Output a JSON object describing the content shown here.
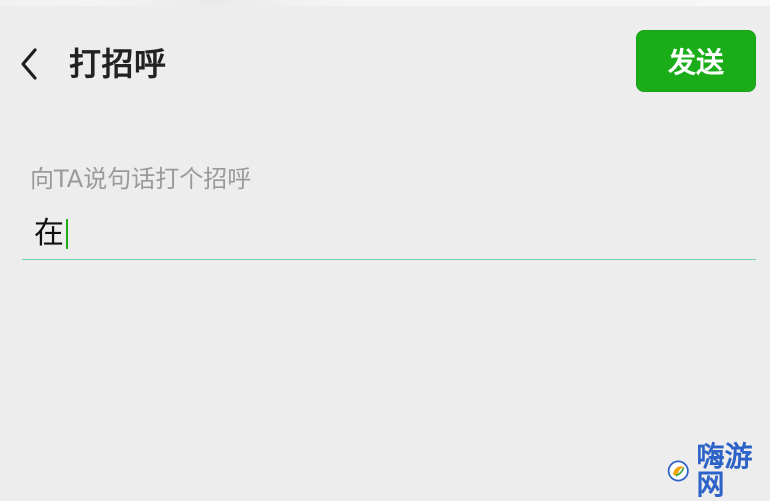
{
  "page": {
    "title": "打招呼",
    "send_label": "发送"
  },
  "message_input": {
    "label": "向TA说句话打个招呼",
    "value": "在"
  },
  "watermark": {
    "text": "嗨游网"
  },
  "icons": {
    "back": "chevron-left-icon",
    "logo": "watermark-logo-icon"
  },
  "colors": {
    "background": "#ededed",
    "primary_green": "#1aad19",
    "underline": "#6ecfb1",
    "watermark_blue": "#2d63c8"
  }
}
